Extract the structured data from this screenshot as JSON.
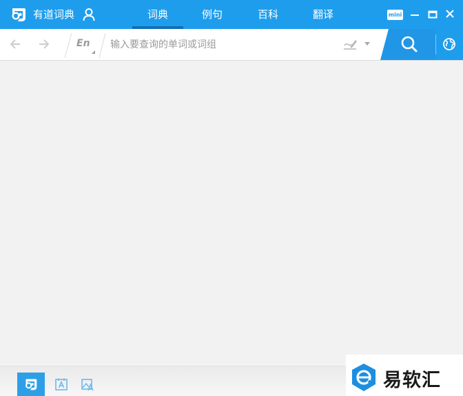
{
  "app": {
    "title": "有道词典"
  },
  "nav": {
    "tabs": [
      {
        "label": "词典",
        "active": true
      },
      {
        "label": "例句",
        "active": false
      },
      {
        "label": "百科",
        "active": false
      },
      {
        "label": "翻译",
        "active": false
      }
    ]
  },
  "window_controls": {
    "mini_label": "mini"
  },
  "search": {
    "lang_label": "En",
    "placeholder": "输入要查询的单词或词组",
    "value": ""
  },
  "bottom_tabs": [
    {
      "icon": "dict-logo-icon",
      "active": true
    },
    {
      "icon": "word-card-icon",
      "active": false
    },
    {
      "icon": "image-translate-icon",
      "active": false
    }
  ],
  "watermark": {
    "text": "易软汇"
  },
  "colors": {
    "accent": "#1e9ded",
    "search_button": "#2196e6",
    "content_bg": "#f2f2f2"
  }
}
